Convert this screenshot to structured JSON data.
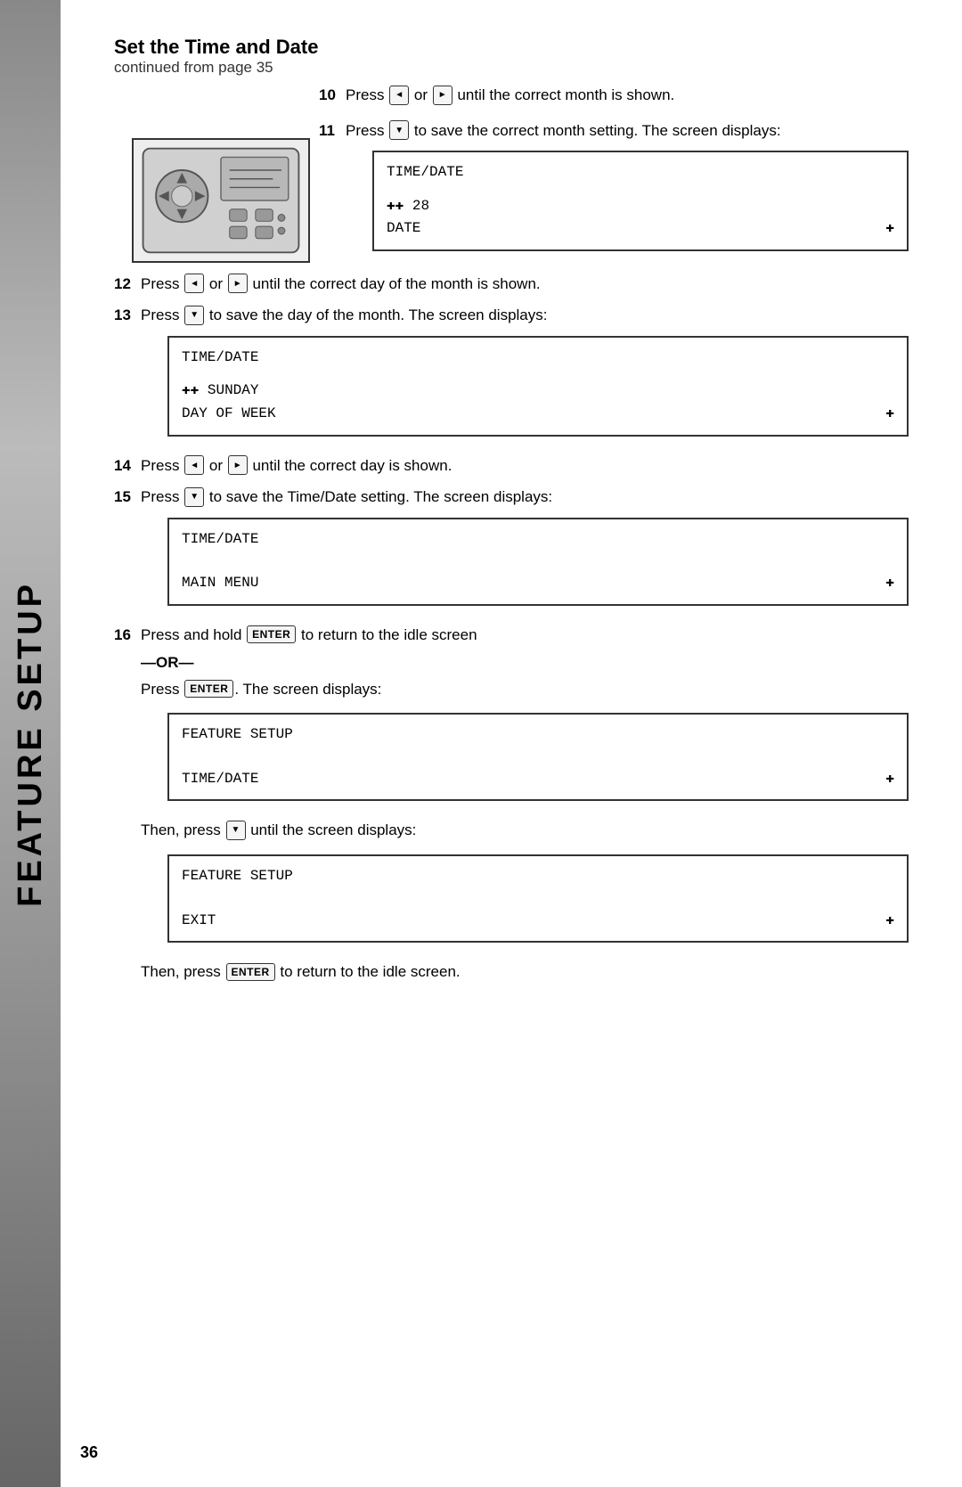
{
  "sidebar": {
    "label": "FEATURE SETUP"
  },
  "header": {
    "title": "Set the Time and Date",
    "subtitle": "continued from page 35"
  },
  "steps": [
    {
      "number": "10",
      "text_before": "Press",
      "button_left": "◄",
      "text_mid": "or",
      "button_right": "►",
      "text_after": "until the correct month is shown."
    },
    {
      "number": "11",
      "text_before": "Press",
      "button": "▼",
      "text_after": "to save the correct month setting. The screen displays:"
    },
    {
      "number": "12",
      "text_before": "Press",
      "button_left": "◄",
      "text_mid": "or",
      "button_right": "►",
      "text_after": "until the correct day of the month is shown."
    },
    {
      "number": "13",
      "text_before": "Press",
      "button": "▼",
      "text_after": "to save the day of the month. The screen displays:"
    },
    {
      "number": "14",
      "text_before": "Press",
      "button_left": "◄",
      "text_mid": "or",
      "button_right": "►",
      "text_after": "until the correct day is shown."
    },
    {
      "number": "15",
      "text_before": "Press",
      "button": "▼",
      "text_after": "to save the Time/Date setting. The screen displays:"
    },
    {
      "number": "16",
      "text_before": "Press and hold",
      "button_enter": "ENTER",
      "text_after": "to return to the idle screen"
    }
  ],
  "screens": {
    "step11": {
      "line1": "TIME/DATE",
      "line2": "❖  28",
      "line3": "DATE",
      "line3_right": "❖"
    },
    "step13": {
      "line1": "TIME/DATE",
      "line2": "❖  SUNDAY",
      "line3": "DAY OF WEEK",
      "line3_right": "❖"
    },
    "step15": {
      "line1": "TIME/DATE",
      "line2": "",
      "line3": "MAIN MENU",
      "line3_right": "❖"
    },
    "step16_or": {
      "line1": "FEATURE SETUP",
      "line2": "",
      "line3": "TIME/DATE",
      "line3_right": "❖"
    },
    "step16_then": {
      "line1": "FEATURE SETUP",
      "line2": "",
      "line3": "EXIT",
      "line3_right": "❖"
    }
  },
  "or_label": "—OR—",
  "press_enter_label": "Press",
  "enter_button": "ENTER",
  "screen_displays": ". The screen displays:",
  "then_press_text": "Then, press",
  "then_press_after": "until the screen displays:",
  "then_press_final": "to return to the idle screen.",
  "page_number": "36"
}
